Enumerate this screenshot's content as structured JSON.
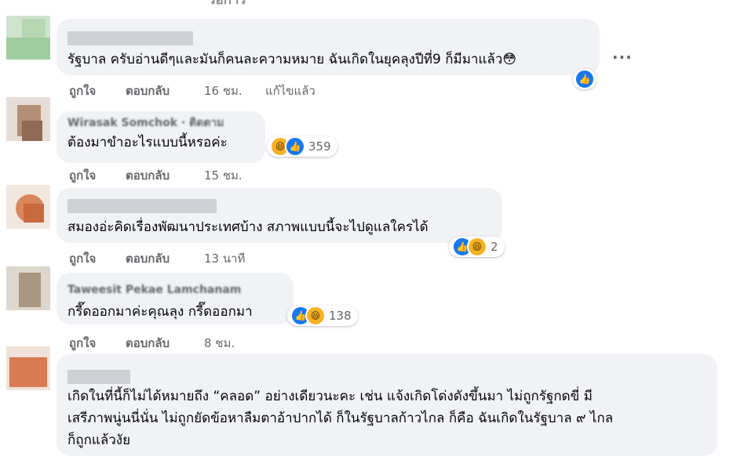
{
  "top_fragment": "วอการ",
  "more_label": "...",
  "comments": [
    {
      "name": "",
      "text_lines": [
        "รัฐบาล ครับอ่านดีๆและมันก็คนละความหมาย ฉันเกิดในยุคลุงปีที่9 ก็มีมาแล้ว😳"
      ],
      "actions": {
        "like": "ถูกใจ",
        "reply": "ตอบกลับ",
        "time": "16 ชม.",
        "edited": "แก้ไขแล้ว"
      },
      "reactions": {
        "icons": [
          "like-icon"
        ],
        "count": ""
      }
    },
    {
      "name": "Wirasak Somchok · ติดตาม",
      "text_lines": [
        "ต้องมาขำอะไรแบบนี้หรอค่ะ"
      ],
      "actions": {
        "like": "ถูกใจ",
        "reply": "ตอบกลับ",
        "time": "15 ชม."
      },
      "reactions": {
        "icons": [
          "haha-icon",
          "like-icon"
        ],
        "count": "359"
      }
    },
    {
      "name": "",
      "text_lines": [
        "สมองอ่ะคิดเรื่องพัฒนาประเทศบ้าง สภาพแบบนี้จะไปดูแลใครได้"
      ],
      "actions": {
        "like": "ถูกใจ",
        "reply": "ตอบกลับ",
        "time": "13 นาที"
      },
      "reactions": {
        "icons": [
          "like-icon",
          "haha-icon"
        ],
        "count": "2"
      }
    },
    {
      "name": "Taweesit Pekae Lamchanam",
      "text_lines": [
        "กรี๊ดออกมาค่ะคุณลุง กรี๊ดออกมา"
      ],
      "actions": {
        "like": "ถูกใจ",
        "reply": "ตอบกลับ",
        "time": "8 ชม."
      },
      "reactions": {
        "icons": [
          "like-icon",
          "haha-icon"
        ],
        "count": "138"
      }
    },
    {
      "name": "",
      "text_lines": [
        "เกิดในที่นี้ก็ไม่ได้หมายถึง “คลอด” อย่างเดียวนะคะ เช่น แจ้งเกิดโด่งดังขึ้นมา ไม่ถูกรัฐกดขี่ มี",
        "เสรีภาพนู่นนี่นั่น ไม่ถูกยัดข้อหาลืมตาอ้าปากได้ ก็ในรัฐบาลก้าวไกล ก็คือ ฉันเกิดในรัฐบาล ๙ ไกล",
        "ก็ถูกแล้วงัย"
      ]
    }
  ],
  "colors": {
    "bubble": "#f0f2f5",
    "like": "#1877f2",
    "haha": "#f7b125",
    "secondary_text": "#65676b"
  }
}
